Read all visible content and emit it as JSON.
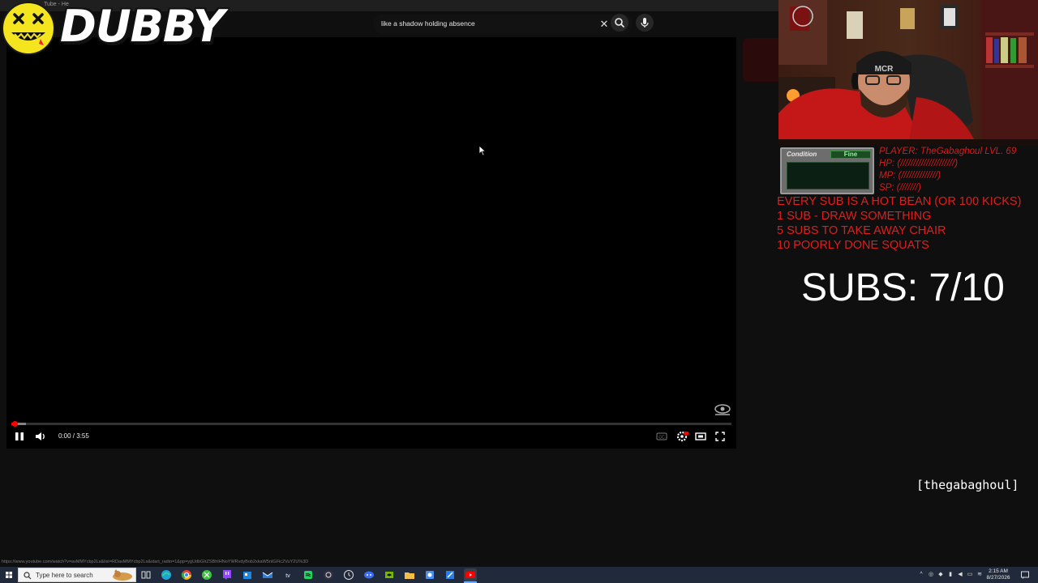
{
  "browser": {
    "tab_title": "Tube - He"
  },
  "youtube": {
    "search_value": "like a shadow holding absence",
    "clear_icon": "close-icon",
    "search_icon": "search-icon",
    "mic_icon": "microphone-icon"
  },
  "player": {
    "time_current": "0:00",
    "time_separator": " / ",
    "time_total": "3:55",
    "progress_fraction": 0.005,
    "buffered_fraction": 0.02,
    "controls": [
      "pause-icon",
      "volume-icon",
      "captions-icon",
      "settings-icon",
      "theater-mode-icon",
      "fullscreen-icon"
    ],
    "accent": "#ff0000"
  },
  "overlay": {
    "logo_text": "DUBBY",
    "condition_label": "Condition",
    "condition_status": "Fine",
    "player_line": "PLAYER: TheGabaghoul LVL. 69",
    "stats": [
      {
        "label": "HP:",
        "bar": "(/////////////////////)"
      },
      {
        "label": "MP:",
        "bar": "(//////////////)"
      },
      {
        "label": "SP:",
        "bar": "(///////)"
      }
    ],
    "goals": [
      "EVERY SUB IS A HOT BEAN (OR 100 KICKS)",
      "1 SUB - DRAW SOMETHING",
      "5 SUBS TO TAKE AWAY CHAIR",
      "10 POORLY DONE SQUATS"
    ],
    "subs_counter": "SUBS: 7/10",
    "channel_tag": "[thegabaghoul]",
    "hud_color": "#d51c1c"
  },
  "status_url": "https://www.youtube.com/watch?v=avMMYcbp2Ls&list=RDavMMYcbp2Ls&start_radio=1&pp=ygUdbGlrZSBhIHNoYWRvdyBob2xkaW5nIGFic2VuY2U%3D",
  "taskbar": {
    "search_placeholder": "Type here to search",
    "time": "2:15 AM",
    "date": "8/27/2026"
  }
}
